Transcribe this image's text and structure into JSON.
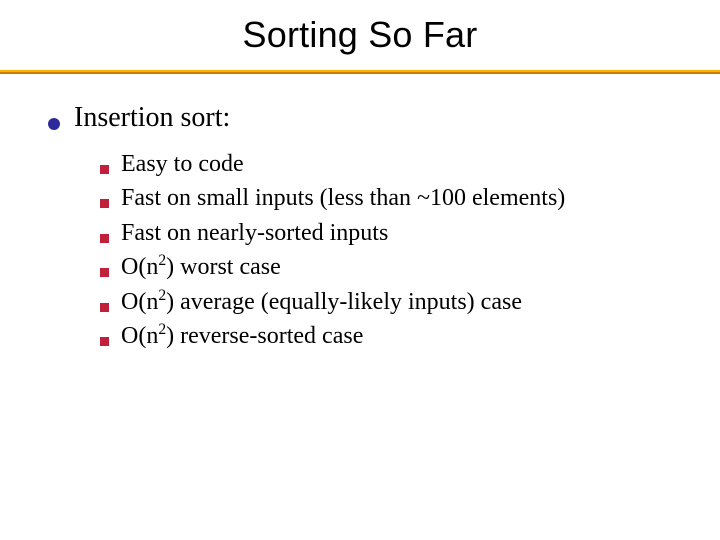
{
  "title": "Sorting So Far",
  "bullets": {
    "main": "Insertion sort:",
    "subs": [
      {
        "text": "Easy to code"
      },
      {
        "text": "Fast on small inputs (less than ~100 elements)"
      },
      {
        "text": "Fast on nearly-sorted inputs"
      },
      {
        "pre": "O(n",
        "sup": "2",
        "post": ") worst case"
      },
      {
        "pre": "O(n",
        "sup": "2",
        "post": ") average (equally-likely inputs) case"
      },
      {
        "pre": "O(n",
        "sup": "2",
        "post": ") reverse-sorted case"
      }
    ]
  }
}
